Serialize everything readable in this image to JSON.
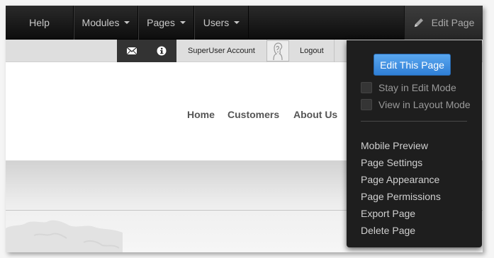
{
  "controlbar": {
    "help": "Help",
    "modules": "Modules",
    "pages": "Pages",
    "users": "Users",
    "edit_page": "Edit Page"
  },
  "userbar": {
    "account": "SuperUser Account",
    "logout": "Logout"
  },
  "nav": {
    "home": "Home",
    "customers": "Customers",
    "about": "About Us"
  },
  "dropdown": {
    "edit_this_page": "Edit This Page",
    "stay_in_edit_mode": "Stay in Edit Mode",
    "view_in_layout_mode": "View in Layout Mode",
    "items": [
      "Mobile Preview",
      "Page Settings",
      "Page Appearance",
      "Page Permissions",
      "Export Page",
      "Delete Page"
    ]
  },
  "colors": {
    "accent_button": "#3b8ee3",
    "controlbar_bg": "#1a1a1a",
    "dropdown_bg": "#1e1e1e"
  },
  "icons": {
    "edit": "pencil-icon",
    "messages": "envelope-icon",
    "notifications": "info-icon",
    "user": "avatar"
  }
}
